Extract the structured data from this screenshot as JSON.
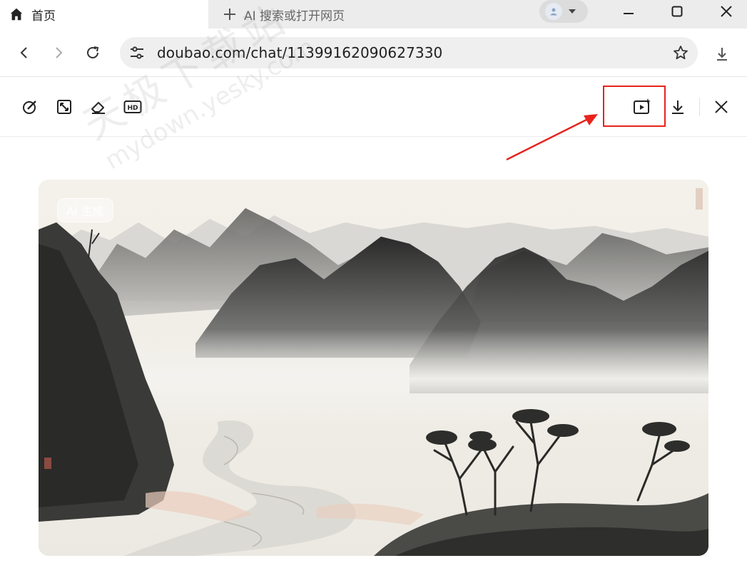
{
  "browser": {
    "tab_title": "首页",
    "new_tab_label": "AI 搜索或打开网页",
    "url": "doubao.com/chat/11399162090627330"
  },
  "icons": {
    "tab": [
      "home-icon",
      "plus-icon",
      "avatar-icon",
      "chevron-down-icon"
    ],
    "window": [
      "minimize-icon",
      "maximize-icon",
      "close-icon"
    ],
    "nav": [
      "back-icon",
      "forward-icon",
      "refresh-icon",
      "site-settings-icon",
      "star-icon",
      "download-icon"
    ],
    "viewer_tools": [
      "edit-icon",
      "expand-icon",
      "eraser-icon",
      "hd-icon",
      "animate-icon",
      "download-icon",
      "close-icon"
    ]
  },
  "viewer": {
    "hd_label": "HD",
    "image_badge": "AI 生成"
  },
  "watermark": {
    "chinese": "天极下载站",
    "english": "mydown.yesky.com"
  },
  "colors": {
    "highlight": "#e8231c",
    "tab_bar_bg": "#ececec",
    "omnibox_bg": "#efefef"
  }
}
